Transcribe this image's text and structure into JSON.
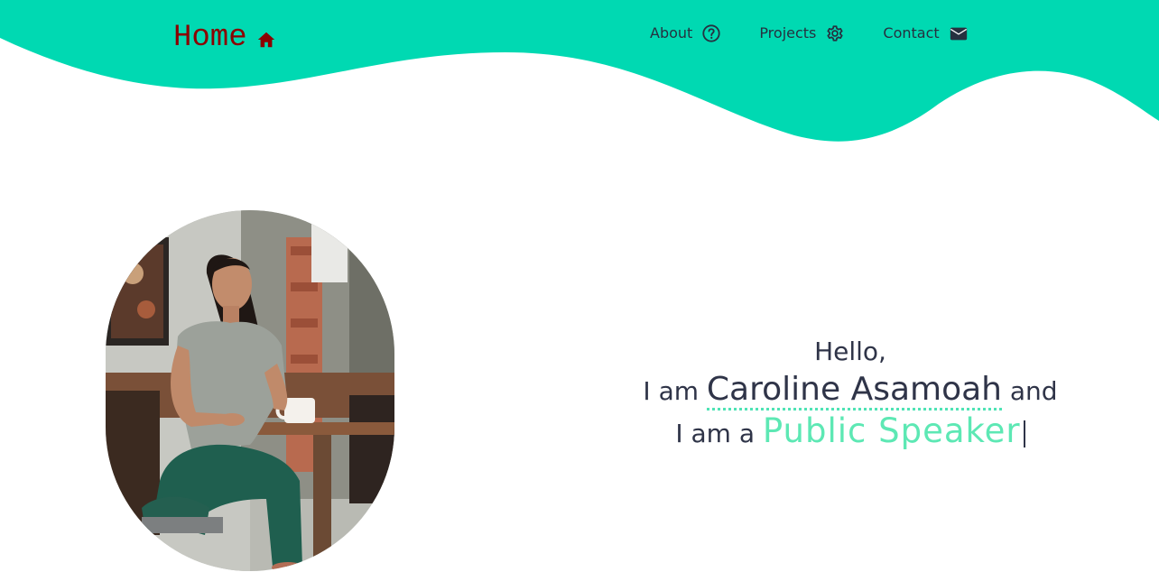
{
  "header": {
    "brand_label": "Home",
    "brand_icon": "home-icon",
    "nav": [
      {
        "label": "About",
        "icon": "question-circle-icon"
      },
      {
        "label": "Projects",
        "icon": "gear-icon"
      },
      {
        "label": "Contact",
        "icon": "envelope-icon"
      }
    ]
  },
  "hero": {
    "greeting": "Hello,",
    "intro_prefix": "I am",
    "name": "Caroline Asamoah",
    "intro_suffix": "and",
    "role_prefix": "I am a",
    "role": "Public Speaker"
  },
  "colors": {
    "wave": "#00d9b2",
    "brand": "#8b0000",
    "nav_text": "#263140",
    "text": "#2f3448",
    "accent": "#5de8b4"
  }
}
